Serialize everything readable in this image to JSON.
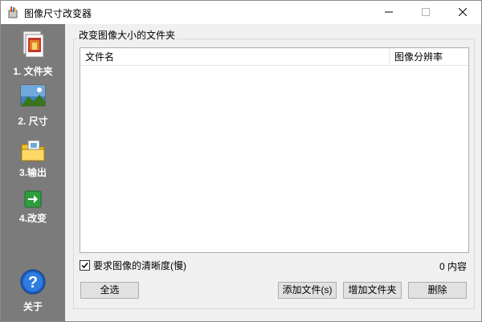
{
  "window": {
    "title": "图像尺寸改变器",
    "app_icon": "pencil-cup-icon"
  },
  "titlebar_buttons": {
    "minimize_icon": "minimize-icon",
    "maximize_icon": "maximize-icon",
    "close_icon": "close-icon"
  },
  "sidebar": {
    "items": [
      {
        "label": "1. 文件夹",
        "icon": "folder-picture-icon"
      },
      {
        "label": "2. 尺寸",
        "icon": "landscape-image-icon"
      },
      {
        "label": "3.输出",
        "icon": "output-folder-icon"
      },
      {
        "label": "4.改变",
        "icon": "green-arrow-icon"
      }
    ],
    "about": {
      "label": "关于",
      "icon": "help-icon"
    }
  },
  "main": {
    "group_title": "改变图像大小的文件夹",
    "list": {
      "columns": [
        "文件名",
        "图像分辨率"
      ],
      "rows": []
    },
    "checkbox": {
      "label": "要求图像的清晰度(慢)",
      "checked": true
    },
    "count": "0 内容",
    "buttons": {
      "select_all": "全选",
      "add_file": "添加文件(s)",
      "add_folder": "增加文件夹",
      "delete": "删除"
    }
  },
  "colors": {
    "sidebar_bg": "#7b7b7b",
    "window_bg": "#f0f0f0",
    "button_bg": "#e1e1e1"
  }
}
